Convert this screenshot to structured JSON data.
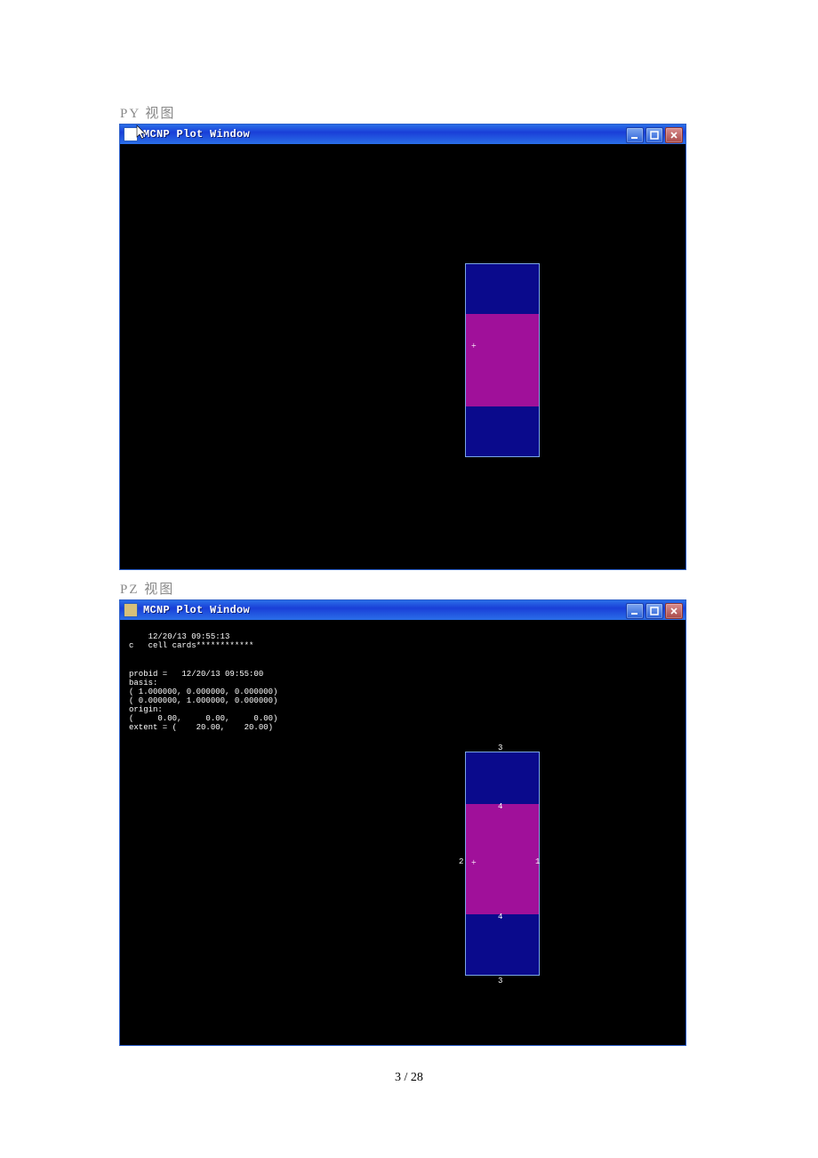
{
  "labels": {
    "view_py": "PY 视图",
    "view_pz": "PZ 视图"
  },
  "window_title": "MCNP Plot Window",
  "page_number": "3 / 28",
  "win2_overlay": {
    "top": "    12/20/13 09:55:13\nc   cell cards************",
    "block": "probid =   12/20/13 09:55:00\nbasis:\n( 1.000000, 0.000000, 0.000000)\n( 0.000000, 1.000000, 0.000000)\norigin:\n(     0.00,     0.00,     0.00)\nextent = (    20.00,    20.00)"
  },
  "annots": {
    "n1": "1",
    "n2": "2",
    "n3": "3",
    "n4top": "4",
    "n4bot": "4",
    "nbot": "3"
  },
  "colors": {
    "frame": "#2b5ec9",
    "titlebar_grad_a": "#2a6fe8",
    "titlebar_grad_b": "#1a3fd8",
    "cap_navy": "#0a0a8c",
    "mid_magenta": "#a0109a",
    "border_light": "#7aa6e6"
  }
}
